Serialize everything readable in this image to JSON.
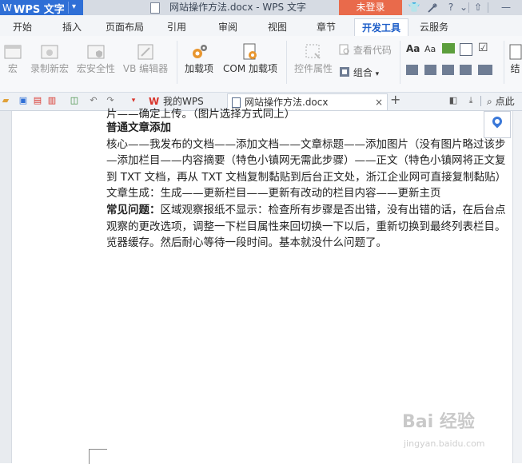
{
  "titlebar": {
    "app_logo": "W",
    "app_name": "WPS 文字",
    "app_caret": "▾",
    "doc_title": "网站操作方法.docx - WPS 文字",
    "login_button": "未登录",
    "shirt_icon": "👕",
    "help_icon": "?",
    "chevron_icon": "⌄",
    "up_icon": "⇧",
    "minimize_icon": "—"
  },
  "menu": {
    "tabs": [
      "开始",
      "插入",
      "页面布局",
      "引用",
      "审阅",
      "视图",
      "章节",
      "开发工具",
      "云服务"
    ],
    "active": "开发工具"
  },
  "ribbon": {
    "macro_label": "宏",
    "record_macro_label": "录制新宏",
    "macro_security_label": "宏安全性",
    "vb_editor_label": "VB 编辑器",
    "addins_label": "加载项",
    "com_addins_label": "COM 加载项",
    "control_props_label": "控件属性",
    "view_code_label": "查看代码",
    "group_label": "组合",
    "group_caret": "▾",
    "controls_truncated_label": "结",
    "font_sample_a1": "Aa",
    "font_sample_a2": "Aa"
  },
  "tabbar": {
    "my_wps_tab": "我的WPS",
    "doc_tab": "网站操作方法.docx",
    "close_icon": "×",
    "new_tab_icon": "+",
    "search_label": "点此"
  },
  "document": {
    "cut_line": "片——确定上传。（图片选择方式同上）",
    "lines": [
      {
        "bold": "普通文章添加",
        "text": ""
      },
      {
        "bold": "",
        "text": "核心——我发布的文档——添加文档——文章标题——添加图片（没有图片略过该步"
      },
      {
        "bold": "",
        "text": "—添加栏目——内容摘要（特色小镇网无需此步骤）——正文（特色小镇网将正文复"
      },
      {
        "bold": "",
        "text": "到 TXT 文档，再从 TXT 文档复制黏贴到后台正文处，浙江企业网可直接复制黏贴）"
      },
      {
        "bold": "",
        "text": "文章生成：生成——更新栏目——更新有改动的栏目内容——更新主页"
      },
      {
        "bold": "常见问题：",
        "text": "区域观察报纸不显示：检查所有步骤是否出错，没有出错的话，在后台点"
      },
      {
        "bold": "",
        "text": "观察的更改选项，调整一下栏目属性来回切换一下以后，重新切换到最终列表栏目。"
      },
      {
        "bold": "",
        "text": "览器缓存。然后耐心等待一段时间。基本就没什么问题了。"
      }
    ]
  },
  "watermark": {
    "text": "Bai 经验",
    "url": "jingyan.baidu.com"
  }
}
